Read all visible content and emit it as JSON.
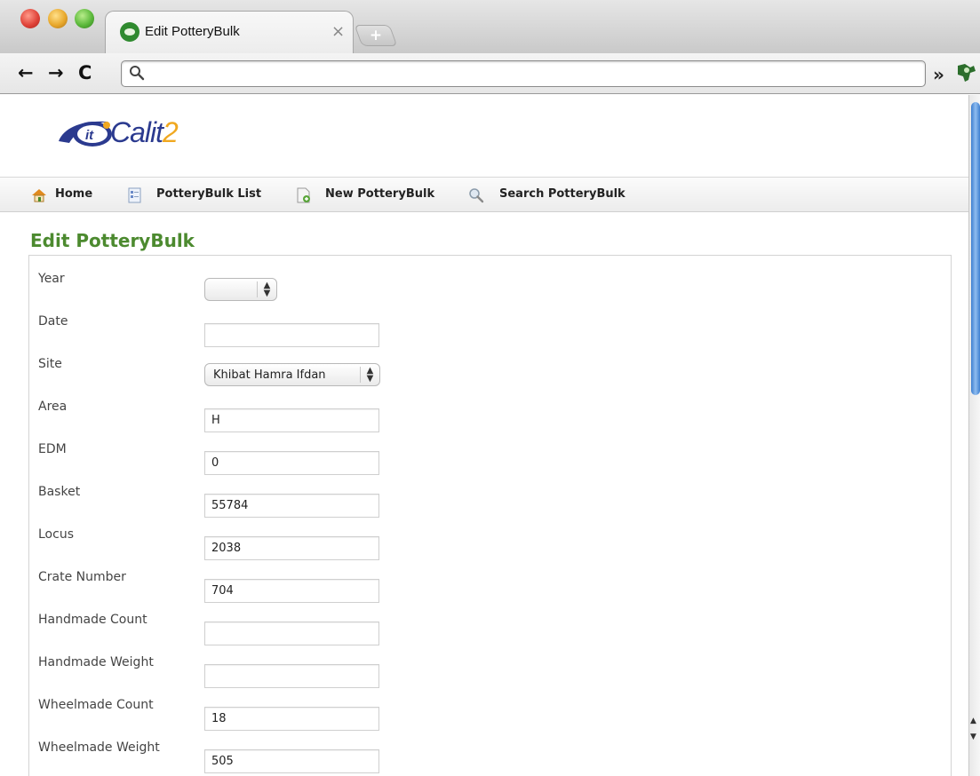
{
  "browser": {
    "tab_title": "Edit PotteryBulk",
    "tab_close": "×",
    "new_tab": "+",
    "url": "",
    "overflow": "»",
    "back": "←",
    "forward": "→",
    "reload": "C"
  },
  "logo": {
    "badge_text": "it",
    "name_main": "Calit",
    "name_suffix": "2"
  },
  "nav": {
    "items": [
      {
        "label": "Home",
        "icon": "home-icon"
      },
      {
        "label": "PotteryBulk List",
        "icon": "list-icon"
      },
      {
        "label": "New PotteryBulk",
        "icon": "new-document-icon"
      },
      {
        "label": "Search PotteryBulk",
        "icon": "search-icon"
      }
    ]
  },
  "page": {
    "title": "Edit PotteryBulk"
  },
  "form": {
    "fields": [
      {
        "label": "Year",
        "type": "select",
        "value": ""
      },
      {
        "label": "Date",
        "type": "text",
        "value": ""
      },
      {
        "label": "Site",
        "type": "select",
        "value": "Khibat Hamra Ifdan"
      },
      {
        "label": "Area",
        "type": "text",
        "value": "H"
      },
      {
        "label": "EDM",
        "type": "text",
        "value": "0"
      },
      {
        "label": "Basket",
        "type": "text",
        "value": "55784"
      },
      {
        "label": "Locus",
        "type": "text",
        "value": "2038"
      },
      {
        "label": "Crate Number",
        "type": "text",
        "value": "704"
      },
      {
        "label": "Handmade Count",
        "type": "text",
        "value": ""
      },
      {
        "label": "Handmade Weight",
        "type": "text",
        "value": ""
      },
      {
        "label": "Wheelmade Count",
        "type": "text",
        "value": "18"
      },
      {
        "label": "Wheelmade Weight",
        "type": "text",
        "value": "505"
      }
    ]
  },
  "colors": {
    "title_green": "#4c8a2f",
    "logo_blue": "#2b3a8f",
    "logo_orange": "#f0a820"
  }
}
